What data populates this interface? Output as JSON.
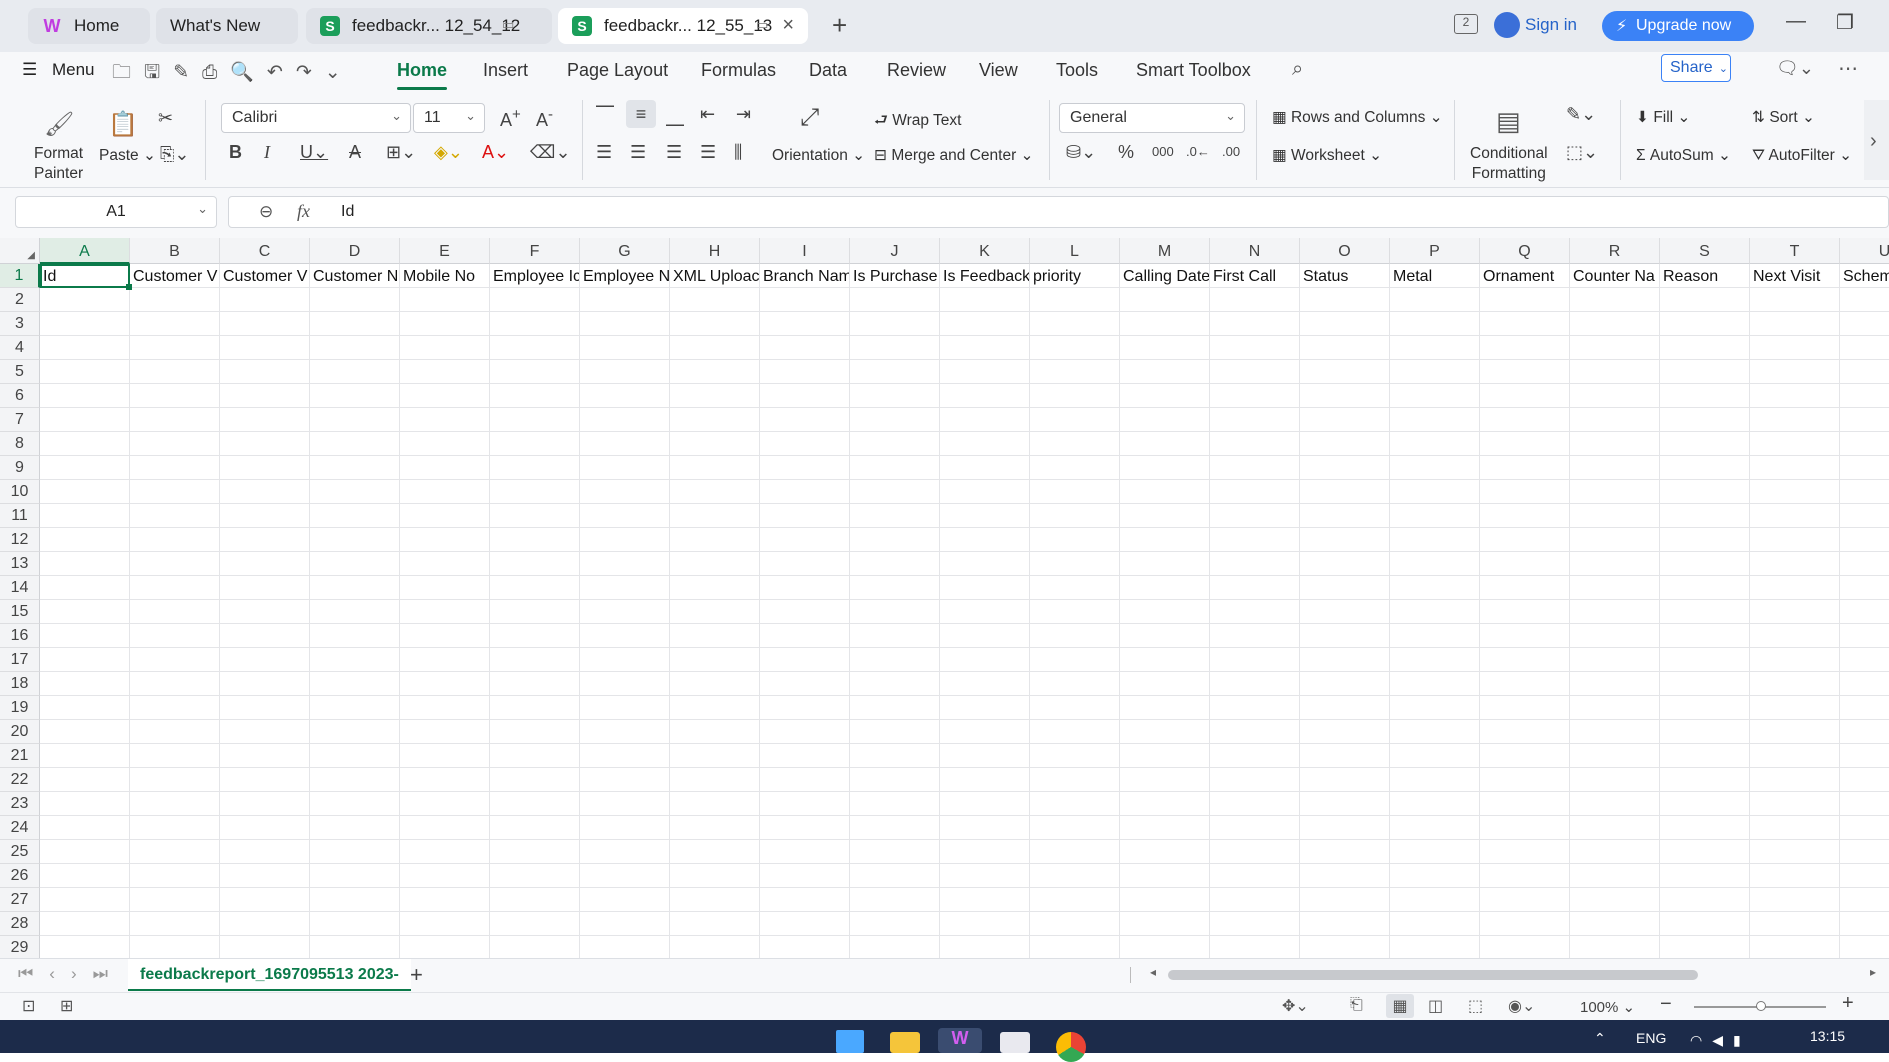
{
  "tabs": [
    {
      "label": "Home",
      "icon": "wps-logo-icon"
    },
    {
      "label": "What's New"
    },
    {
      "label": "feedbackr... 12_54_12",
      "icon": "spreadsheet-icon"
    },
    {
      "label": "feedbackr... 12_55_13",
      "icon": "spreadsheet-icon",
      "active": true
    }
  ],
  "titlebar": {
    "badge": "2",
    "sign_in": "Sign in",
    "upgrade": "Upgrade now"
  },
  "menu": {
    "menu_label": "Menu",
    "tabs": [
      "Home",
      "Insert",
      "Page Layout",
      "Formulas",
      "Data",
      "Review",
      "View",
      "Tools",
      "Smart Toolbox"
    ],
    "active": "Home",
    "share": "Share"
  },
  "ribbon": {
    "format_painter": "Format\nPainter",
    "paste": "Paste",
    "font_name": "Calibri",
    "font_size": "11",
    "wrap_text": "Wrap Text",
    "orientation": "Orientation",
    "merge_center": "Merge and Center",
    "number_format": "General",
    "rows_columns": "Rows and Columns",
    "worksheet": "Worksheet",
    "conditional_formatting": "Conditional\nFormatting",
    "fill": "Fill",
    "sort": "Sort",
    "autosum": "AutoSum",
    "autofilter": "AutoFilter"
  },
  "formula_bar": {
    "cell_ref": "A1",
    "content": "Id"
  },
  "columns": [
    "A",
    "B",
    "C",
    "D",
    "E",
    "F",
    "G",
    "H",
    "I",
    "J",
    "K",
    "L",
    "M",
    "N",
    "O",
    "P",
    "Q",
    "R",
    "S",
    "T",
    "U"
  ],
  "header_row": [
    "Id",
    "Customer V",
    "Customer V",
    "Customer N",
    "Mobile No",
    "Employee Ic",
    "Employee N",
    "XML Uploac",
    "Branch Nam",
    "Is Purchase",
    "Is Feedback",
    "priority",
    "Calling Date",
    "First Call",
    "Status",
    "Metal",
    "Ornament",
    "Counter Na",
    "Reason",
    "Next Visit",
    "Schem"
  ],
  "rows": [
    "1",
    "2",
    "3",
    "4",
    "5",
    "6",
    "7",
    "8",
    "9",
    "10",
    "11",
    "12",
    "13",
    "14",
    "15",
    "16",
    "17",
    "18",
    "19",
    "20",
    "21",
    "22",
    "23",
    "24",
    "25",
    "26",
    "27",
    "28",
    "29"
  ],
  "sheet_tab": "feedbackreport_1697095513 2023-",
  "status": {
    "zoom": "100%"
  },
  "taskbar": {
    "lang": "ENG",
    "time": "13:15"
  },
  "colors": {
    "accent": "#0b7a4a",
    "upgrade": "#3b82f6",
    "taskbar": "#1c2b4a"
  }
}
